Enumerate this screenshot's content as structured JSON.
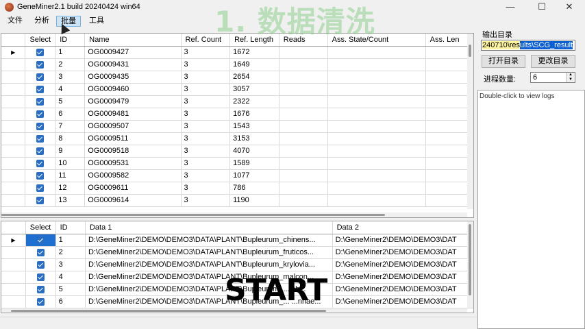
{
  "window": {
    "title": "GeneMiner2.1 build 20240424 win64",
    "minimize": "—",
    "maximize": "☐",
    "close": "✕"
  },
  "menu": [
    "文件",
    "分析",
    "批量",
    "工具"
  ],
  "overlay": {
    "title": "1. 数据清洗",
    "start": "START"
  },
  "top_grid": {
    "columns": [
      "Select",
      "ID",
      "Name",
      "Ref. Count",
      "Ref. Length",
      "Reads",
      "Ass. State/Count",
      "Ass. Len"
    ],
    "rows": [
      {
        "id": "1",
        "name": "OG0009427",
        "ref_count": "3",
        "ref_length": "1672"
      },
      {
        "id": "2",
        "name": "OG0009431",
        "ref_count": "3",
        "ref_length": "1649"
      },
      {
        "id": "3",
        "name": "OG0009435",
        "ref_count": "3",
        "ref_length": "2654"
      },
      {
        "id": "4",
        "name": "OG0009460",
        "ref_count": "3",
        "ref_length": "3057"
      },
      {
        "id": "5",
        "name": "OG0009479",
        "ref_count": "3",
        "ref_length": "2322"
      },
      {
        "id": "6",
        "name": "OG0009481",
        "ref_count": "3",
        "ref_length": "1676"
      },
      {
        "id": "7",
        "name": "OG0009507",
        "ref_count": "3",
        "ref_length": "1543"
      },
      {
        "id": "8",
        "name": "OG0009511",
        "ref_count": "3",
        "ref_length": "3153"
      },
      {
        "id": "9",
        "name": "OG0009518",
        "ref_count": "3",
        "ref_length": "4070"
      },
      {
        "id": "10",
        "name": "OG0009531",
        "ref_count": "3",
        "ref_length": "1589"
      },
      {
        "id": "11",
        "name": "OG0009582",
        "ref_count": "3",
        "ref_length": "1077"
      },
      {
        "id": "12",
        "name": "OG0009611",
        "ref_count": "3",
        "ref_length": "786"
      },
      {
        "id": "13",
        "name": "OG0009614",
        "ref_count": "3",
        "ref_length": "1190"
      }
    ]
  },
  "bottom_grid": {
    "columns": [
      "Select",
      "ID",
      "Data 1",
      "Data 2"
    ],
    "rows": [
      {
        "id": "1",
        "data1": "D:\\GeneMiner2\\DEMO\\DEMO3\\DATA\\PLANT\\Bupleurum_chinens...",
        "data2": "D:\\GeneMiner2\\DEMO\\DEMO3\\DAT"
      },
      {
        "id": "2",
        "data1": "D:\\GeneMiner2\\DEMO\\DEMO3\\DATA\\PLANT\\Bupleurum_fruticos...",
        "data2": "D:\\GeneMiner2\\DEMO\\DEMO3\\DAT"
      },
      {
        "id": "3",
        "data1": "D:\\GeneMiner2\\DEMO\\DEMO3\\DATA\\PLANT\\Bupleurum_krylovia...",
        "data2": "D:\\GeneMiner2\\DEMO\\DEMO3\\DAT"
      },
      {
        "id": "4",
        "data1": "D:\\GeneMiner2\\DEMO\\DEMO3\\DATA\\PLANT\\Bupleurum_malcon...",
        "data2": "D:\\GeneMiner2\\DEMO\\DEMO3\\DAT"
      },
      {
        "id": "5",
        "data1": "D:\\GeneMiner2\\DEMO\\DEMO3\\DATA\\PLANT\\Bupleurum_... ch...",
        "data2": "D:\\GeneMiner2\\DEMO\\DEMO3\\DAT"
      },
      {
        "id": "6",
        "data1": "D:\\GeneMiner2\\DEMO\\DEMO3\\DATA\\PLANT\\Bupleurum_... ...nnae...",
        "data2": "D:\\GeneMiner2\\DEMO\\DEMO3\\DAT"
      }
    ]
  },
  "right_panel": {
    "output_label": "输出目录",
    "output_path_pre": "240710\\res",
    "output_path_hl": "ults\\SCG_result",
    "open_dir": "打开目录",
    "change_dir": "更改目录",
    "threads_label": "进程数量:",
    "threads_value": "6",
    "log_hint": "Double-click to view logs"
  }
}
